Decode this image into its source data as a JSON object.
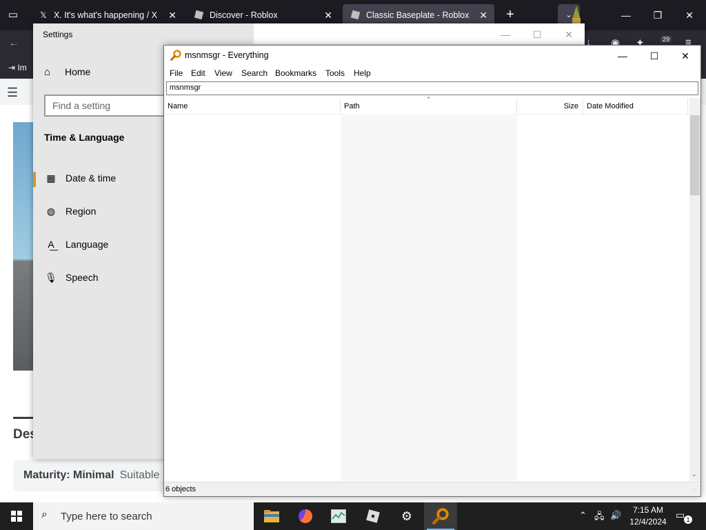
{
  "browser": {
    "tabs": [
      {
        "label": "X. It's what's happening / X",
        "favicon": "x-logo-icon"
      },
      {
        "label": "Discover - Roblox",
        "favicon": "roblox-icon"
      },
      {
        "label": "Classic Baseplate - Roblox",
        "favicon": "roblox-icon"
      }
    ],
    "bookmark_label": "Im",
    "extension_badge": "29",
    "page": {
      "heading_partial": "Des",
      "maturity_label": "Maturity: Minimal",
      "maturity_note": "Suitable"
    }
  },
  "settings": {
    "title": "Settings",
    "home_label": "Home",
    "search_placeholder": "Find a setting",
    "section_title": "Time & Language",
    "nav_items": [
      {
        "label": "Date & time",
        "icon": "calendar-clock-icon",
        "selected": true
      },
      {
        "label": "Region",
        "icon": "globe-icon",
        "selected": false
      },
      {
        "label": "Language",
        "icon": "language-icon",
        "selected": false
      },
      {
        "label": "Speech",
        "icon": "microphone-icon",
        "selected": false
      }
    ],
    "accent_color": "#d29a2a"
  },
  "everything": {
    "title": "msnmsgr - Everything",
    "menu": [
      "File",
      "Edit",
      "View",
      "Search",
      "Bookmarks",
      "Tools",
      "Help"
    ],
    "search_value": "msnmsgr",
    "columns": [
      "Name",
      "Path",
      "Size",
      "Date Modified"
    ],
    "status": "6 objects"
  },
  "taskbar": {
    "search_placeholder": "Type here to search",
    "apps": [
      "file-explorer-icon",
      "firefox-icon",
      "task-manager-icon",
      "roblox-icon",
      "settings-gear-icon",
      "everything-search-icon"
    ],
    "time": "7:15 AM",
    "date": "12/4/2024",
    "notification_count": "1"
  }
}
